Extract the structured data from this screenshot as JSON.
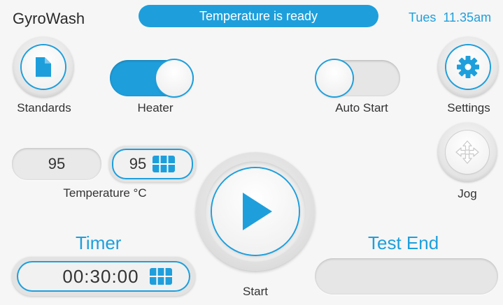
{
  "header": {
    "app_title": "GyroWash",
    "status_message": "Temperature is ready",
    "clock_day": "Tues",
    "clock_time": "11.35am"
  },
  "buttons": {
    "standards_label": "Standards",
    "settings_label": "Settings",
    "jog_label": "Jog",
    "start_label": "Start"
  },
  "toggles": {
    "heater": {
      "label": "Heater",
      "state": "on"
    },
    "auto_start": {
      "label": "Auto Start",
      "state": "off"
    }
  },
  "temperature": {
    "label": "Temperature °C",
    "current_value": "95",
    "setpoint_value": "95"
  },
  "timer": {
    "title": "Timer",
    "value": "00:30:00"
  },
  "test_end": {
    "title": "Test End",
    "value": ""
  },
  "icons": {
    "standards": "document-icon",
    "settings": "gear-icon",
    "jog": "move-arrows-icon",
    "start": "play-icon",
    "keypad": "keypad-icon"
  },
  "colors": {
    "accent": "#1e9fdc",
    "background": "#f6f6f6"
  }
}
